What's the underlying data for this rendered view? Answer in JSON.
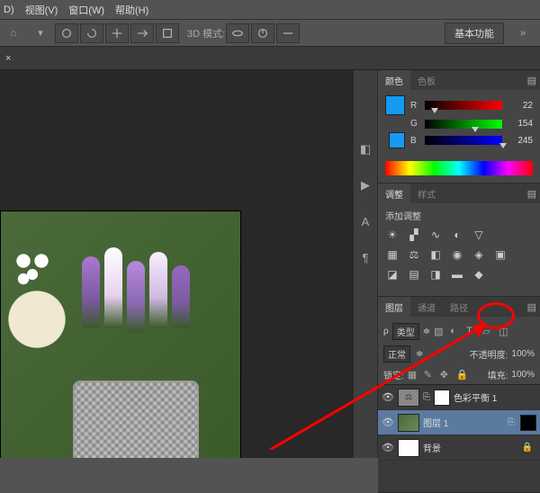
{
  "menus": {
    "d": "D)",
    "view": "视图(V)",
    "window": "窗口(W)",
    "help": "帮助(H)"
  },
  "toolbar": {
    "mode3d": "3D 模式:",
    "basic": "基本功能"
  },
  "color_panel": {
    "tab_color": "颜色",
    "tab_swatch": "色板",
    "r": "R",
    "g": "G",
    "b": "B",
    "r_val": "22",
    "g_val": "154",
    "b_val": "245"
  },
  "adjust_panel": {
    "tab_adjust": "调整",
    "tab_style": "样式",
    "title": "添加调整"
  },
  "layers_panel": {
    "tab_layers": "图层",
    "tab_channels": "通道",
    "tab_paths": "路径",
    "kind": "类型",
    "blend": "正常",
    "opacity_label": "不透明度:",
    "opacity_val": "100%",
    "lock_label": "锁定:",
    "fill_label": "填充:",
    "fill_val": "100%",
    "layer_adj": "色彩平衡 1",
    "layer_copy": "图层 1",
    "layer_bg": "背景"
  },
  "chart_data": null
}
